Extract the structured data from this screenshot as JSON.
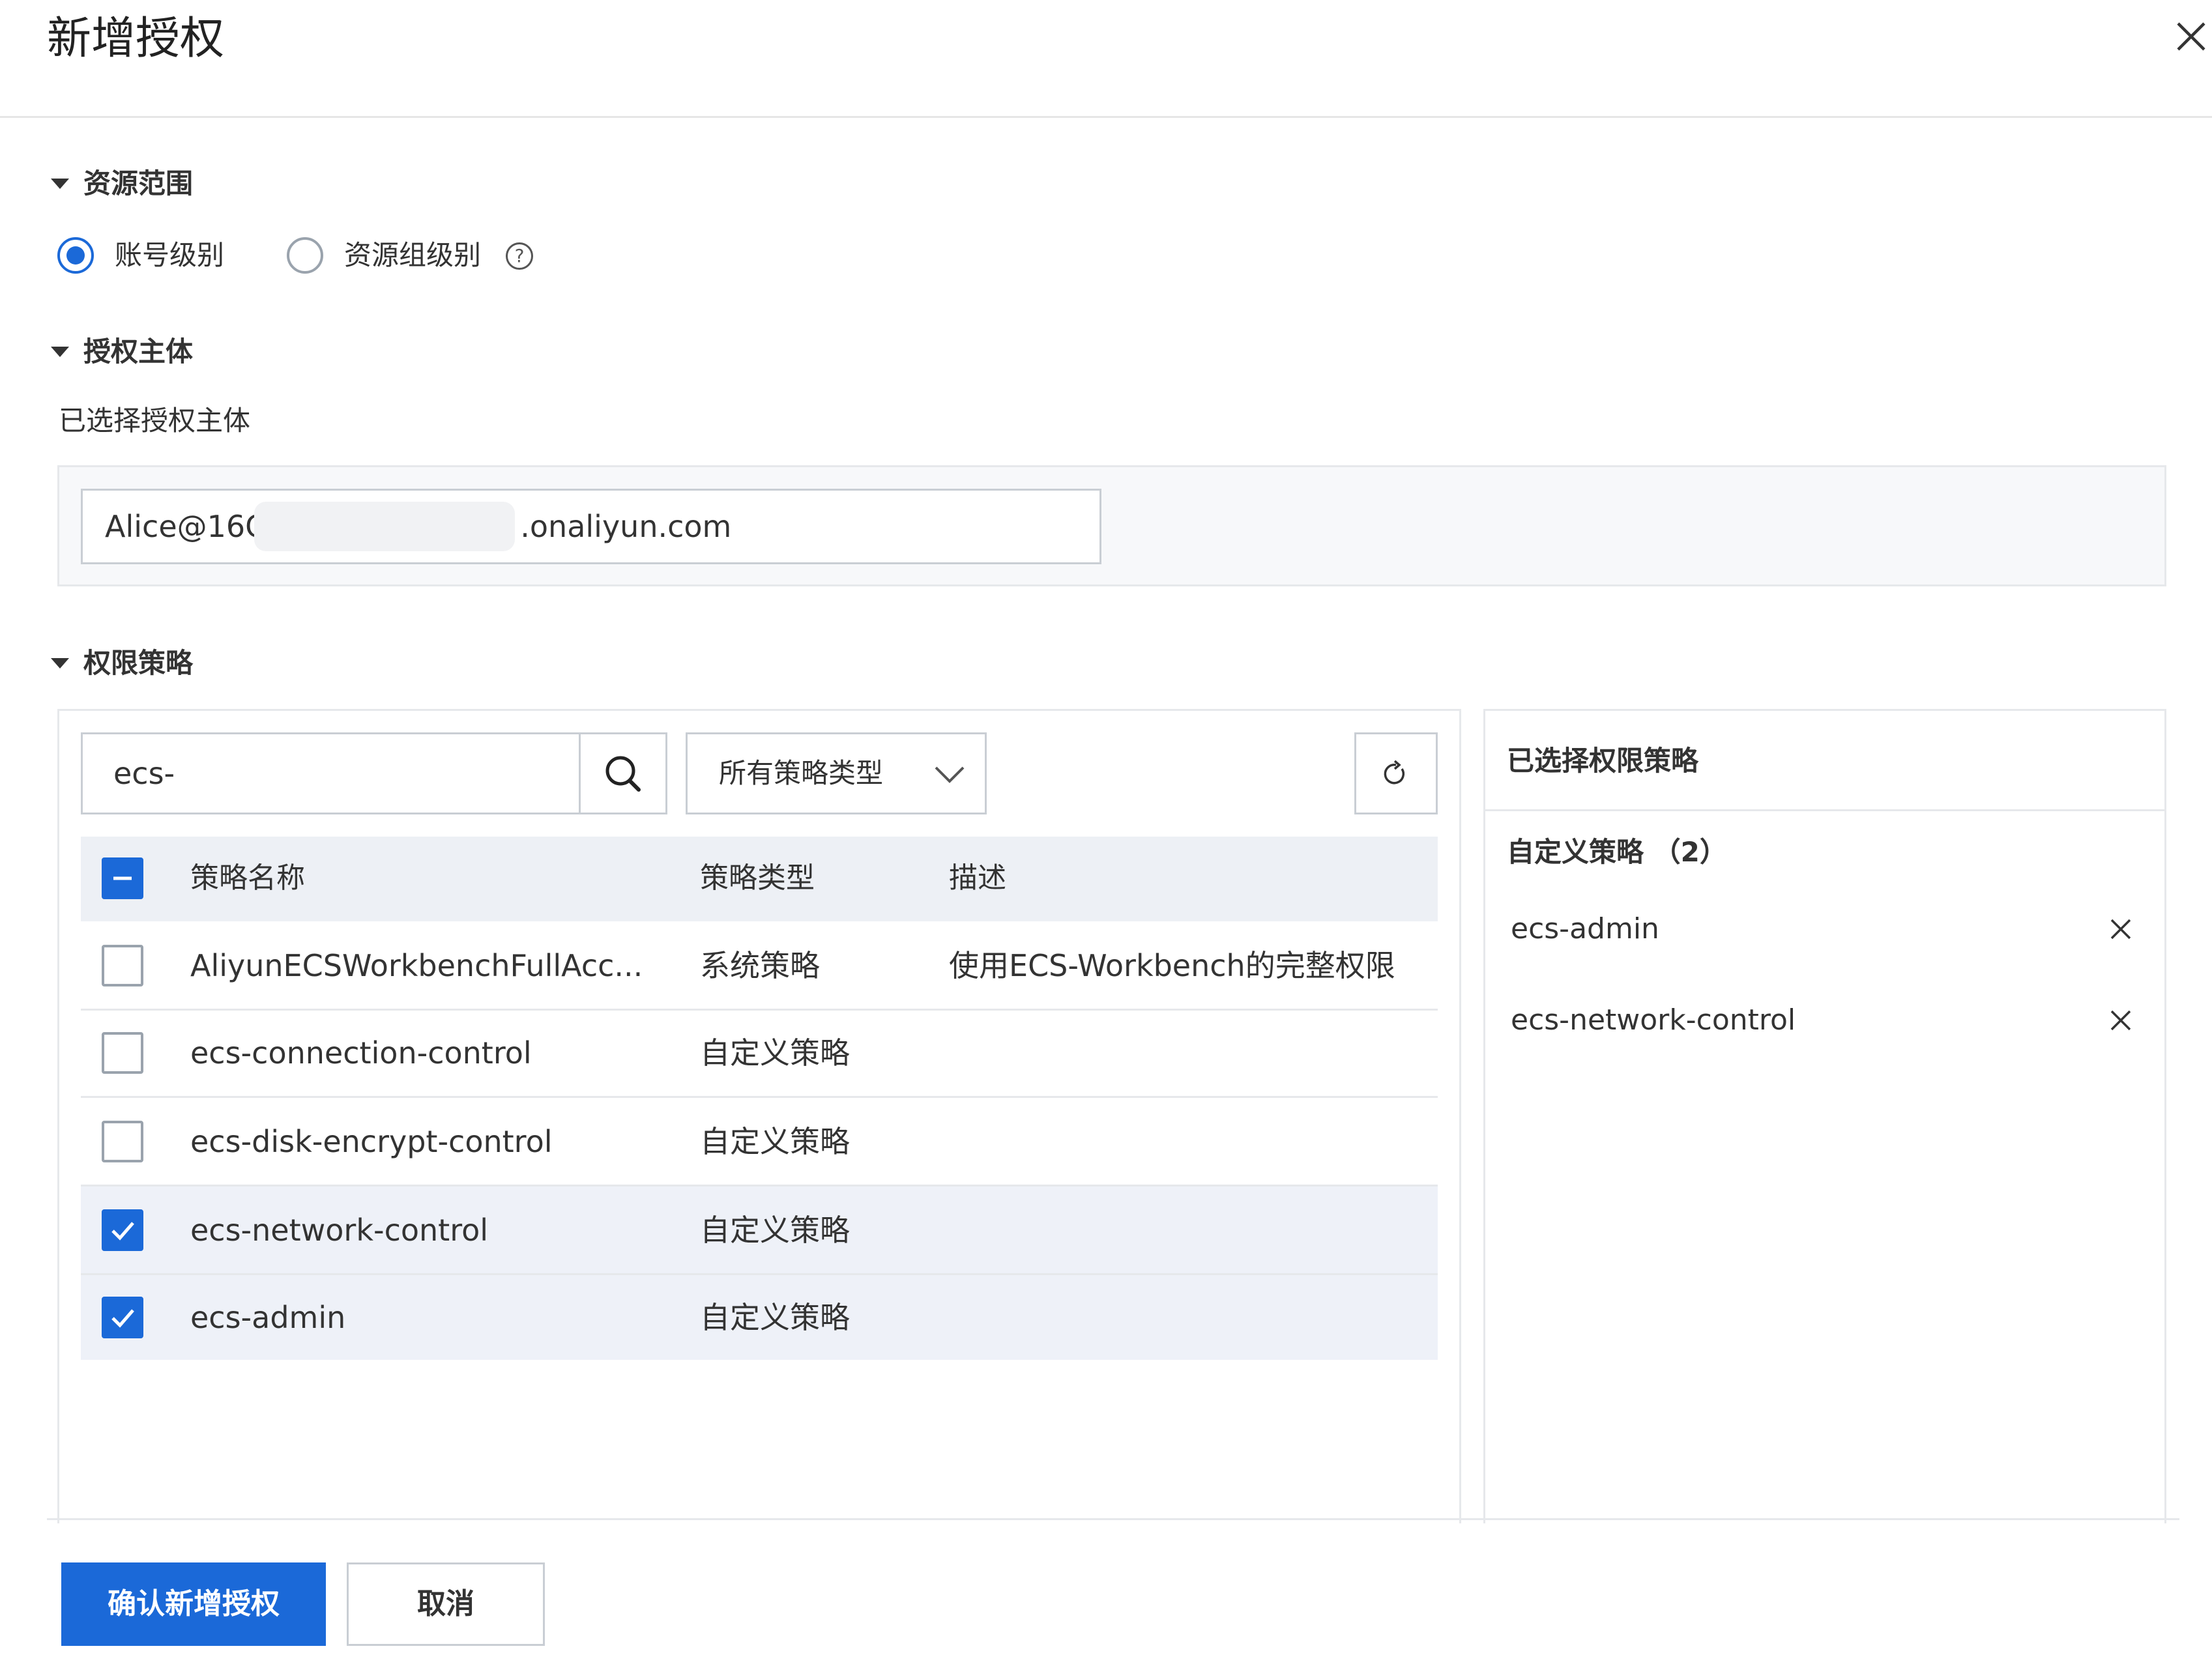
{
  "dialog": {
    "title": "新增授权"
  },
  "resource_scope": {
    "section_title": "资源范围",
    "options": [
      {
        "label": "账号级别",
        "selected": true
      },
      {
        "label": "资源组级别",
        "selected": false
      }
    ],
    "help_icon": "question-circle-icon",
    "help_glyph": "?"
  },
  "principal": {
    "section_title": "授权主体",
    "selected_label": "已选择授权主体",
    "value_prefix": "Alice@16C",
    "value_suffix": ".onaliyun.com"
  },
  "policy": {
    "section_title": "权限策略",
    "search": {
      "value": "ecs-",
      "icon": "search-icon"
    },
    "type_filter": {
      "selected": "所有策略类型",
      "icon": "chevron-down-icon"
    },
    "refresh_icon": "refresh-icon",
    "table": {
      "header_checkbox_state": "partial",
      "columns": [
        "策略名称",
        "策略类型",
        "描述"
      ],
      "rows": [
        {
          "name": "AliyunECSWorkbenchFullAcc...",
          "type": "系统策略",
          "desc": "使用ECS-Workbench的完整权限",
          "checked": false
        },
        {
          "name": "ecs-connection-control",
          "type": "自定义策略",
          "desc": "",
          "checked": false
        },
        {
          "name": "ecs-disk-encrypt-control",
          "type": "自定义策略",
          "desc": "",
          "checked": false
        },
        {
          "name": "ecs-network-control",
          "type": "自定义策略",
          "desc": "",
          "checked": true
        },
        {
          "name": "ecs-admin",
          "type": "自定义策略",
          "desc": "",
          "checked": true
        }
      ]
    }
  },
  "selected_policies": {
    "title": "已选择权限策略",
    "group_label": "自定义策略 （2）",
    "items": [
      "ecs-admin",
      "ecs-network-control"
    ],
    "remove_icon": "close-icon"
  },
  "footer": {
    "confirm_label": "确认新增授权",
    "cancel_label": "取消"
  },
  "colors": {
    "primary": "#1b69d8",
    "selected_row": "#eef1f8",
    "header_row": "#edf0f5"
  }
}
